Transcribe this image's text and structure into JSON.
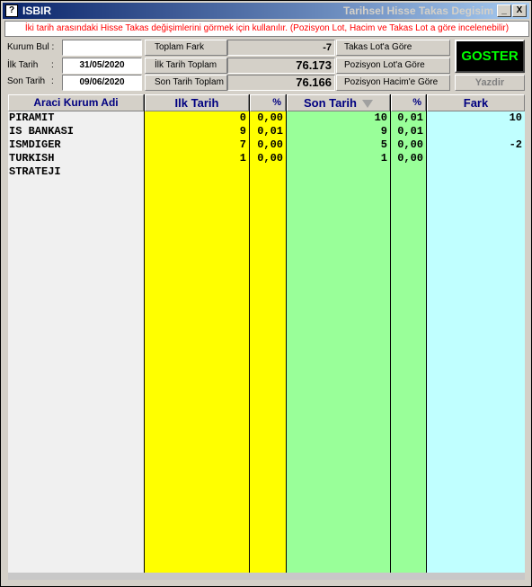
{
  "window": {
    "title": "ISBIR",
    "subtitle": "Tarihsel Hisse Takas Degisim",
    "min_label": "_",
    "close_label": "X",
    "icon_label": "?"
  },
  "info_text": "İki tarih arasındaki Hisse Takas değişimlerini görmek için kullanılır. (Pozisyon Lot, Hacim ve Takas Lot a göre incelenebilir)",
  "filters": {
    "kurum_bul_label": "Kurum Bul :",
    "kurum_bul_value": "",
    "ilk_tarih_label": "İlk Tarih",
    "ilk_tarih_value": "31/05/2020",
    "son_tarih_label": "Son Tarih",
    "son_tarih_value": "09/06/2020",
    "colon": ":"
  },
  "summary": {
    "toplam_fark_label": "Toplam Fark",
    "toplam_fark_value": "-7",
    "ilk_tarih_toplam_label": "İlk Tarih Toplam",
    "ilk_tarih_toplam_value": "76.173",
    "son_tarih_toplam_label": "Son Tarih Toplam",
    "son_tarih_toplam_value": "76.166"
  },
  "options": {
    "takas_lot": "Takas Lot'a Göre",
    "pozisyon_lot": "Pozisyon Lot'a Göre",
    "pozisyon_hacim": "Pozisyon Hacim'e Göre"
  },
  "actions": {
    "goster": "GOSTER",
    "yazdir": "Yazdir"
  },
  "colors": {
    "ilk_tarih_col": "#ffff00",
    "son_tarih_col": "#99ff99",
    "fark_col": "#c0ffff",
    "name_col": "#f0f0f0",
    "goster_text": "#00ff00",
    "info_text": "#ff0000"
  },
  "grid": {
    "headers": {
      "kurum": "Araci Kurum Adi",
      "ilk_tarih": "Ilk Tarih",
      "ilk_pct": "%",
      "son_tarih": "Son Tarih",
      "son_pct": "%",
      "fark": "Fark"
    },
    "rows": [
      {
        "kurum": "PIRAMIT",
        "ilk": "0",
        "ilk_pct": "0,00",
        "son": "10",
        "son_pct": "0,01",
        "fark": "10"
      },
      {
        "kurum": "IS BANKASI",
        "ilk": "9",
        "ilk_pct": "0,01",
        "son": "9",
        "son_pct": "0,01",
        "fark": ""
      },
      {
        "kurum": "ISMDIGER",
        "ilk": "7",
        "ilk_pct": "0,00",
        "son": "5",
        "son_pct": "0,00",
        "fark": "-2"
      },
      {
        "kurum": "TURKISH",
        "ilk": "1",
        "ilk_pct": "0,00",
        "son": "1",
        "son_pct": "0,00",
        "fark": ""
      },
      {
        "kurum": "STRATEJI",
        "ilk": "",
        "ilk_pct": "",
        "son": "",
        "son_pct": "",
        "fark": ""
      }
    ]
  }
}
